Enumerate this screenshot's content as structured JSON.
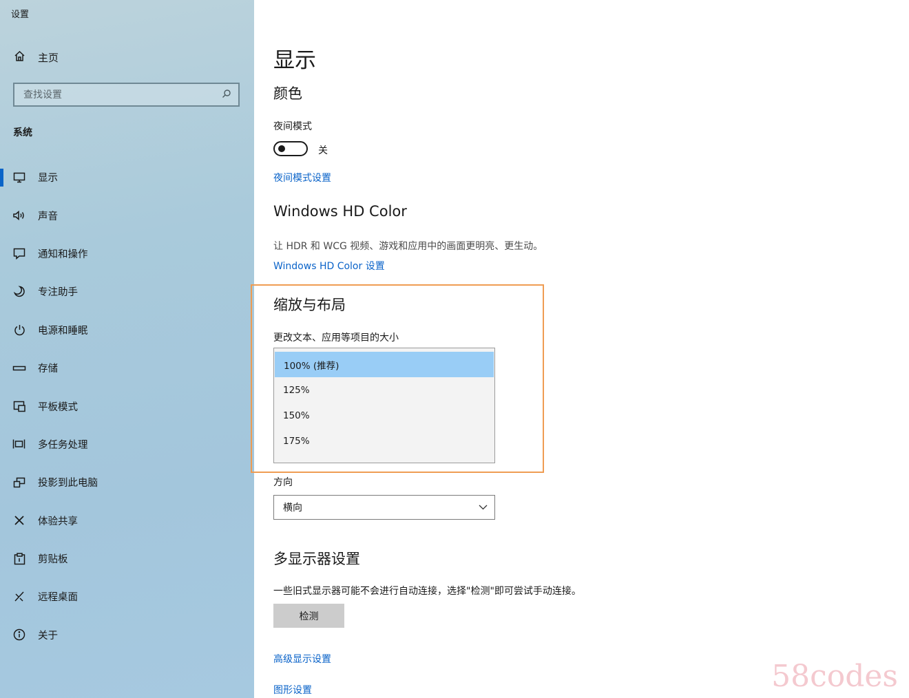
{
  "app": {
    "title": "设置"
  },
  "sidebar": {
    "home_label": "主页",
    "search_placeholder": "查找设置",
    "section_label": "系统",
    "items": [
      {
        "label": "显示",
        "icon": "monitor-icon",
        "active": true
      },
      {
        "label": "声音",
        "icon": "speaker-icon"
      },
      {
        "label": "通知和操作",
        "icon": "notification-icon"
      },
      {
        "label": "专注助手",
        "icon": "moon-icon"
      },
      {
        "label": "电源和睡眠",
        "icon": "power-icon"
      },
      {
        "label": "存储",
        "icon": "storage-icon"
      },
      {
        "label": "平板模式",
        "icon": "tablet-icon"
      },
      {
        "label": "多任务处理",
        "icon": "multitask-icon"
      },
      {
        "label": "投影到此电脑",
        "icon": "project-icon"
      },
      {
        "label": "体验共享",
        "icon": "share-icon"
      },
      {
        "label": "剪贴板",
        "icon": "clipboard-icon"
      },
      {
        "label": "远程桌面",
        "icon": "remote-icon"
      },
      {
        "label": "关于",
        "icon": "info-icon"
      }
    ]
  },
  "main": {
    "title": "显示",
    "color_heading": "颜色",
    "night_label": "夜间模式",
    "night_state": "关",
    "night_link": "夜间模式设置",
    "hd_heading": "Windows HD Color",
    "hd_desc": "让 HDR 和 WCG 视频、游戏和应用中的画面更明亮、更生动。",
    "hd_link": "Windows HD Color 设置",
    "scale_heading": "缩放与布局",
    "scale_label": "更改文本、应用等项目的大小",
    "scale_options": [
      "100% (推荐)",
      "125%",
      "150%",
      "175%"
    ],
    "orientation_label": "方向",
    "orientation_value": "横向",
    "multi_heading": "多显示器设置",
    "multi_desc": "一些旧式显示器可能不会进行自动连接，选择\"检测\"即可尝试手动连接。",
    "detect_button": "检测",
    "adv_link": "高级显示设置",
    "graphics_link": "图形设置"
  },
  "watermark": "58codes",
  "colors": {
    "accent": "#0a63c9",
    "highlight_border": "#ef9c52",
    "selected_option": "#99cdf6"
  }
}
